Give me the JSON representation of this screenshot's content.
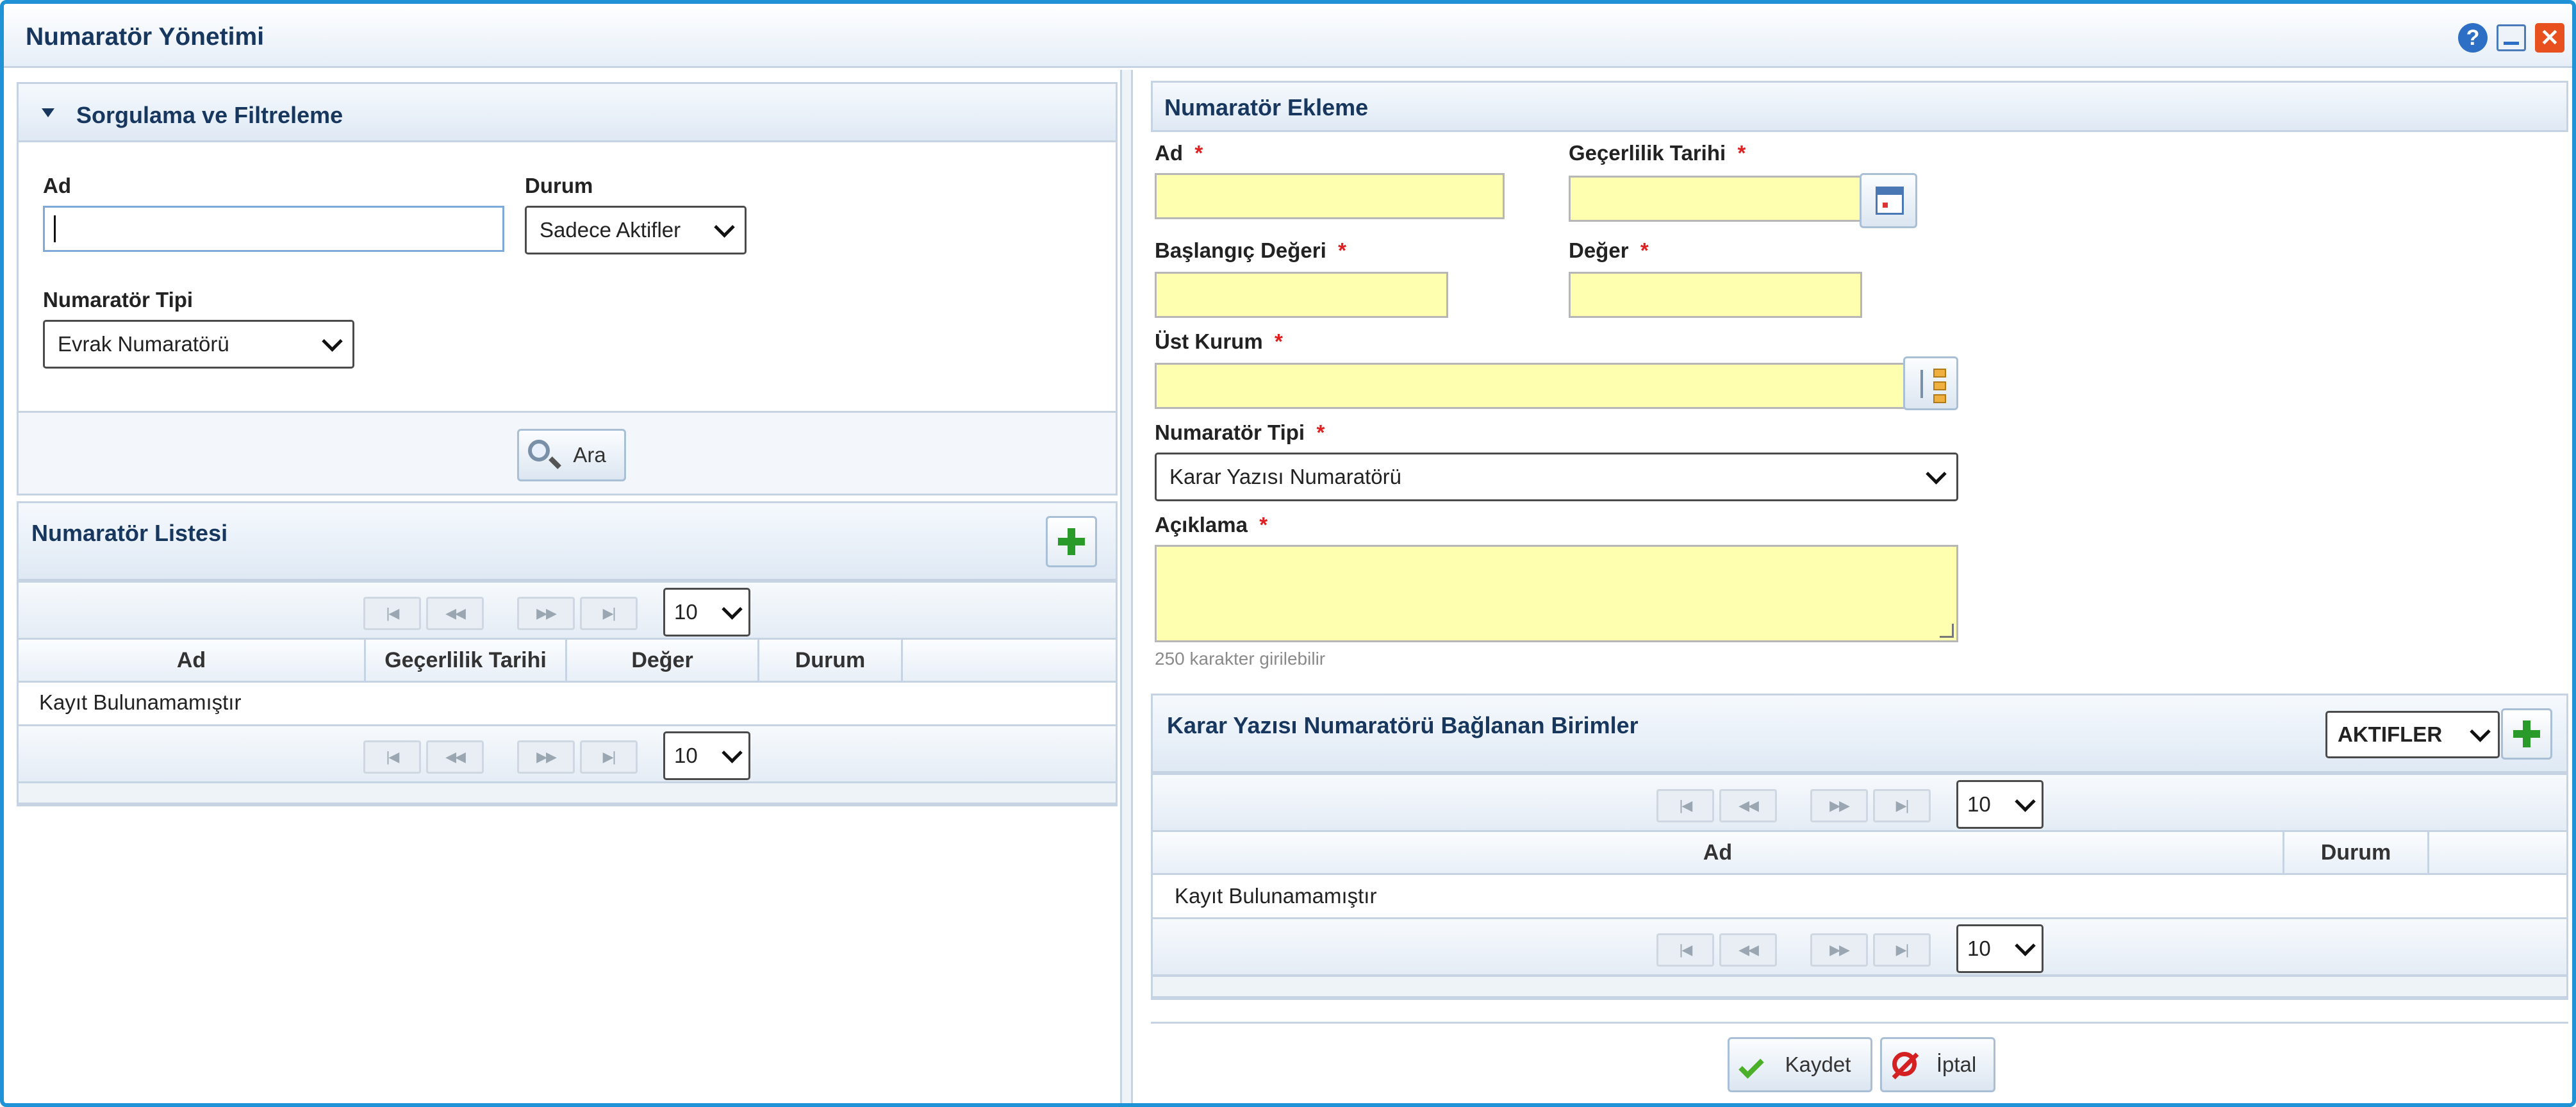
{
  "window": {
    "title": "Numaratör Yönetimi",
    "icons": [
      "help-icon",
      "minimize-icon",
      "close-icon"
    ]
  },
  "filter": {
    "header": "Sorgulama ve Filtreleme",
    "ad_label": "Ad",
    "ad_value": "",
    "durum_label": "Durum",
    "durum_value": "Sadece Aktifler",
    "tip_label": "Numaratör Tipi",
    "tip_value": "Evrak Numaratörü",
    "search_button": "Ara"
  },
  "list": {
    "header": "Numaratör Listesi",
    "page_size": "10",
    "columns": [
      "Ad",
      "Geçerlilik Tarihi",
      "Değer",
      "Durum"
    ],
    "empty": "Kayıt Bulunamamıştır",
    "pager_buttons": [
      "first",
      "prev",
      "next",
      "last"
    ]
  },
  "form": {
    "header": "Numaratör Ekleme",
    "ad_label": "Ad",
    "gecerlilik_label": "Geçerlilik Tarihi",
    "baslangic_label": "Başlangıç Değeri",
    "deger_label": "Değer",
    "ust_kurum_label": "Üst Kurum",
    "tip_label": "Numaratör Tipi",
    "tip_value": "Karar Yazısı Numaratörü",
    "aciklama_label": "Açıklama",
    "char_hint": "250 karakter girilebilir",
    "required_mark": "*"
  },
  "units": {
    "header": "Karar Yazısı Numaratörü Bağlanan Birimler",
    "filter_value": "AKTIFLER",
    "page_size": "10",
    "columns": [
      "Ad",
      "Durum"
    ],
    "empty": "Kayıt Bulunamamıştır"
  },
  "actions": {
    "save": "Kaydet",
    "cancel": "İptal"
  },
  "colors": {
    "accent": "#1f93d6",
    "required": "#e02020",
    "required_field": "#ffffb0",
    "header_text": "#17375e"
  }
}
